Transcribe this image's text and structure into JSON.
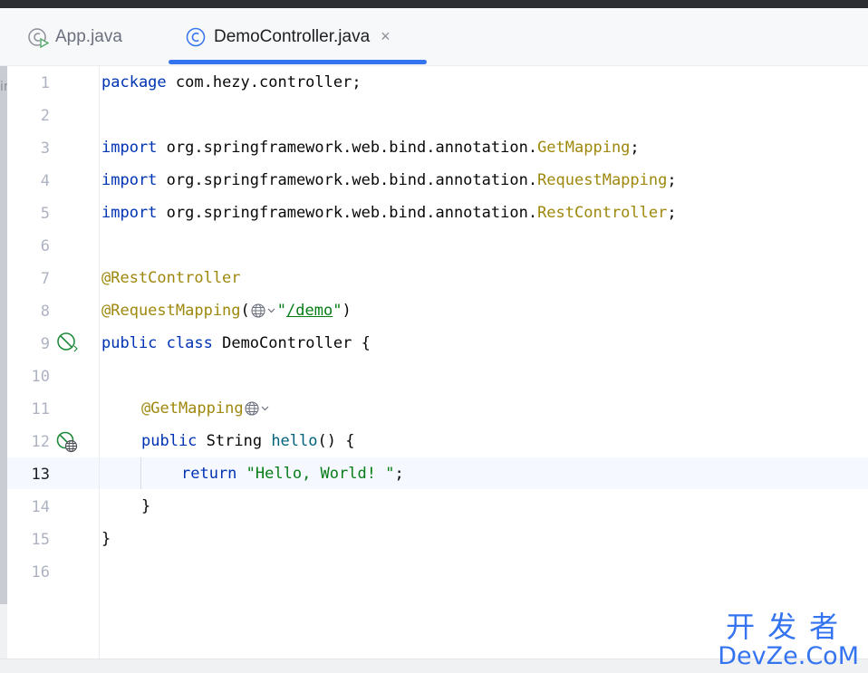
{
  "tabs": [
    {
      "label": "App.java",
      "icon": "java-run-class-icon",
      "active": false
    },
    {
      "label": "DemoController.java",
      "icon": "java-class-icon",
      "active": true,
      "close": "×"
    }
  ],
  "sidebar_clip_text": "ir",
  "editor": {
    "current_line": 13,
    "line_numbers": [
      "1",
      "2",
      "3",
      "4",
      "5",
      "6",
      "7",
      "8",
      "9",
      "10",
      "11",
      "12",
      "13",
      "14",
      "15",
      "16"
    ],
    "lines": {
      "l1": {
        "kw": "package",
        "rest": " com.hezy.controller;"
      },
      "l3": {
        "kw": "import",
        "pkg": " org.springframework.web.bind.annotation.",
        "cls": "GetMapping",
        "end": ";"
      },
      "l4": {
        "kw": "import",
        "pkg": " org.springframework.web.bind.annotation.",
        "cls": "RequestMapping",
        "end": ";"
      },
      "l5": {
        "kw": "import",
        "pkg": " org.springframework.web.bind.annotation.",
        "cls": "RestController",
        "end": ";"
      },
      "l7": {
        "ann": "@RestController"
      },
      "l8": {
        "ann": "@RequestMapping",
        "open": "(",
        "q1": "\"",
        "path": "/demo",
        "q2": "\"",
        "close": ")"
      },
      "l9": {
        "kw1": "public",
        "kw2": "class",
        "rest": " DemoController {"
      },
      "l11": {
        "ann": "@GetMapping"
      },
      "l12": {
        "kw": "public",
        "type": " String ",
        "fn": "hello",
        "rest": "() {"
      },
      "l13": {
        "kw": "return",
        "str": "\"Hello, World! \"",
        "end": ";"
      },
      "l14": {
        "text": "}"
      },
      "l15": {
        "text": "}"
      }
    }
  },
  "watermark": {
    "cn": "开发者",
    "en": "DevZe.CoM"
  },
  "colors": {
    "keyword": "#0033b3",
    "annotation": "#9e880d",
    "string": "#067d17",
    "method": "#00627a",
    "accent": "#3574f0"
  }
}
